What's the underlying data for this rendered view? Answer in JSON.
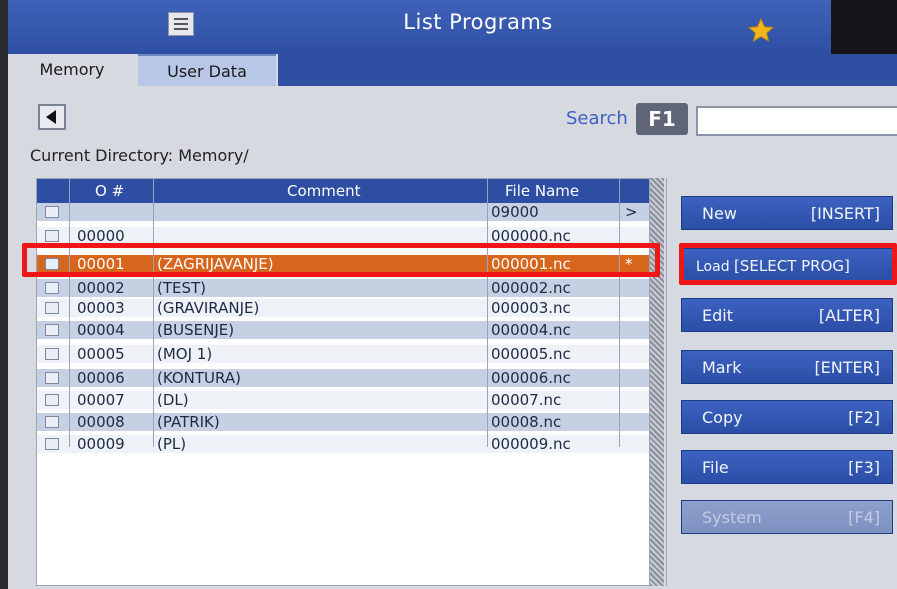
{
  "title": "List Programs",
  "tabs": {
    "memory": "Memory",
    "user_data": "User Data"
  },
  "search": {
    "label": "Search",
    "key": "F1",
    "value": ""
  },
  "current_directory": "Current Directory: Memory/",
  "table": {
    "columns": [
      "O #",
      "Comment",
      "File Name"
    ],
    "rows": [
      {
        "onum": "",
        "comment": "",
        "file": "09000",
        "flag": ">"
      },
      {
        "onum": "00000",
        "comment": "",
        "file": "000000.nc",
        "flag": ""
      },
      {
        "onum": "00001",
        "comment": "(ZAGRIJAVANJE)",
        "file": "000001.nc",
        "flag": "*"
      },
      {
        "onum": "00002",
        "comment": "(TEST)",
        "file": "000002.nc",
        "flag": ""
      },
      {
        "onum": "00003",
        "comment": "(GRAVIRANJE)",
        "file": "000003.nc",
        "flag": ""
      },
      {
        "onum": "00004",
        "comment": "(BUSENJE)",
        "file": "000004.nc",
        "flag": ""
      },
      {
        "onum": "00005",
        "comment": "(MOJ 1)",
        "file": "000005.nc",
        "flag": ""
      },
      {
        "onum": "00006",
        "comment": "(KONTURA)",
        "file": "000006.nc",
        "flag": ""
      },
      {
        "onum": "00007",
        "comment": "(DL)",
        "file": "00007.nc",
        "flag": ""
      },
      {
        "onum": "00008",
        "comment": "(PATRIK)",
        "file": "00008.nc",
        "flag": ""
      },
      {
        "onum": "00009",
        "comment": "(PL)",
        "file": "000009.nc",
        "flag": ""
      }
    ]
  },
  "buttons": {
    "new": {
      "label": "New",
      "key": "[INSERT]"
    },
    "load": {
      "label": "Load",
      "key": "[SELECT PROG]"
    },
    "edit": {
      "label": "Edit",
      "key": "[ALTER]"
    },
    "mark": {
      "label": "Mark",
      "key": "[ENTER]"
    },
    "copy": {
      "label": "Copy",
      "key": "[F2]"
    },
    "file": {
      "label": "File",
      "key": "[F3]"
    },
    "system": {
      "label": "System",
      "key": "[F4]"
    }
  },
  "colors": {
    "titlebar": "#2e4fa3",
    "selected_row": "#d8651c",
    "highlight": "#ee1616",
    "star": "#f2b51c"
  },
  "icons": [
    "menu-icon",
    "star-icon",
    "back-arrow-icon"
  ]
}
